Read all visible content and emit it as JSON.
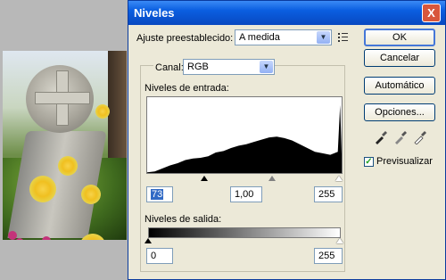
{
  "dialog": {
    "title": "Niveles",
    "close_symbol": "X"
  },
  "preset": {
    "label": "Ajuste preestablecido:",
    "value": "A medida"
  },
  "channel": {
    "label": "Canal:",
    "value": "RGB"
  },
  "input_levels": {
    "label": "Niveles de entrada:",
    "black": "73",
    "gamma": "1,00",
    "white": "255"
  },
  "output_levels": {
    "label": "Niveles de salida:",
    "black": "0",
    "white": "255"
  },
  "buttons": {
    "ok": "OK",
    "cancel": "Cancelar",
    "auto": "Automático",
    "options": "Opciones..."
  },
  "preview": {
    "label": "Previsualizar",
    "checked": true
  },
  "chart_data": {
    "type": "area",
    "x": [
      0,
      10,
      20,
      30,
      40,
      50,
      60,
      70,
      80,
      90,
      100,
      110,
      120,
      130,
      140,
      150,
      160,
      170,
      180,
      190,
      200,
      210,
      220,
      230,
      240,
      250,
      253,
      255
    ],
    "values": [
      1,
      2,
      6,
      10,
      13,
      17,
      19,
      20,
      22,
      27,
      29,
      33,
      36,
      38,
      41,
      44,
      47,
      48,
      46,
      43,
      38,
      33,
      28,
      26,
      24,
      28,
      90,
      25
    ],
    "xlim": [
      0,
      255
    ],
    "title": "",
    "xlabel": "",
    "ylabel": ""
  }
}
